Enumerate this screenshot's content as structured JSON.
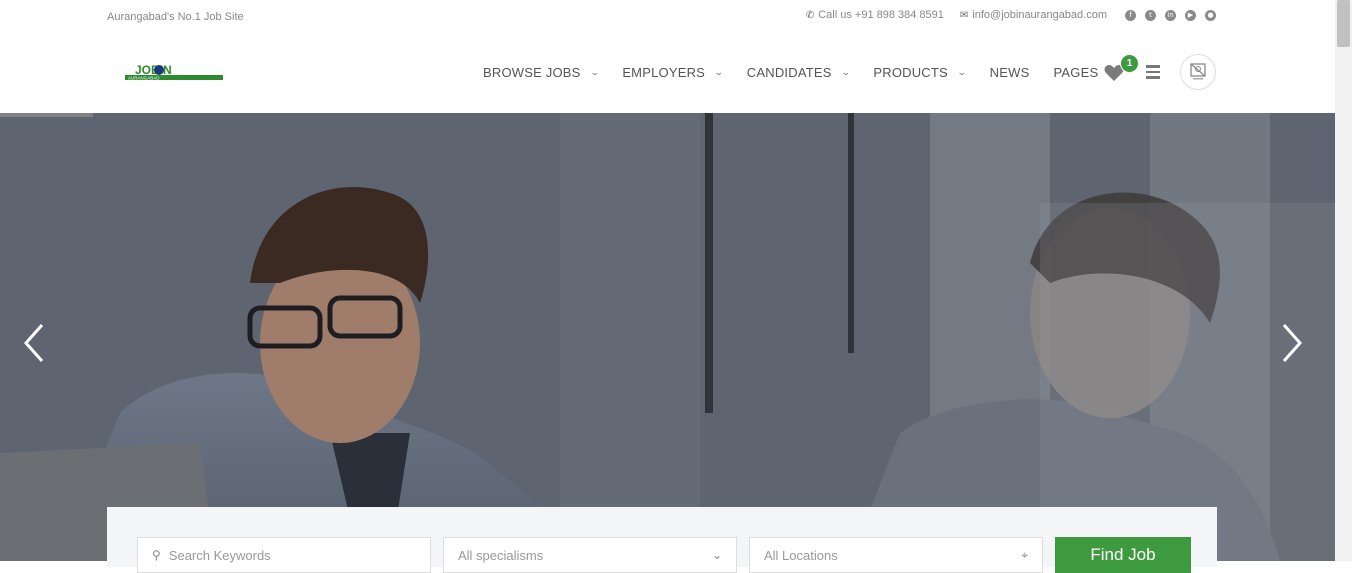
{
  "topbar": {
    "tagline": "Aurangabad's No.1 Job Site",
    "phone": "Call us +91 898 384 8591",
    "email": "info@jobinaurangabad.com",
    "social_icons": [
      "facebook-icon",
      "twitter-icon",
      "linkedin-icon",
      "youtube-icon",
      "other-social-icon"
    ]
  },
  "logo": {
    "text": "JOBIN",
    "sub": "AURANGABAD"
  },
  "nav": {
    "items": [
      {
        "label": "BROWSE JOBS",
        "dropdown": true
      },
      {
        "label": "EMPLOYERS",
        "dropdown": true
      },
      {
        "label": "CANDIDATES",
        "dropdown": true
      },
      {
        "label": "PRODUCTS",
        "dropdown": true
      },
      {
        "label": "NEWS",
        "dropdown": false
      },
      {
        "label": "PAGES",
        "dropdown": true
      }
    ],
    "wishlist_count": "1"
  },
  "hero": {
    "prev_icon": "chevron-left-icon",
    "next_icon": "chevron-right-icon"
  },
  "search": {
    "keywords_placeholder": "Search Keywords",
    "specialisms_value": "All specialisms",
    "locations_placeholder": "All Locations",
    "button_label": "Find Job"
  },
  "colors": {
    "accent": "#3e9a3e",
    "hero_overlay": "#5b616b"
  }
}
